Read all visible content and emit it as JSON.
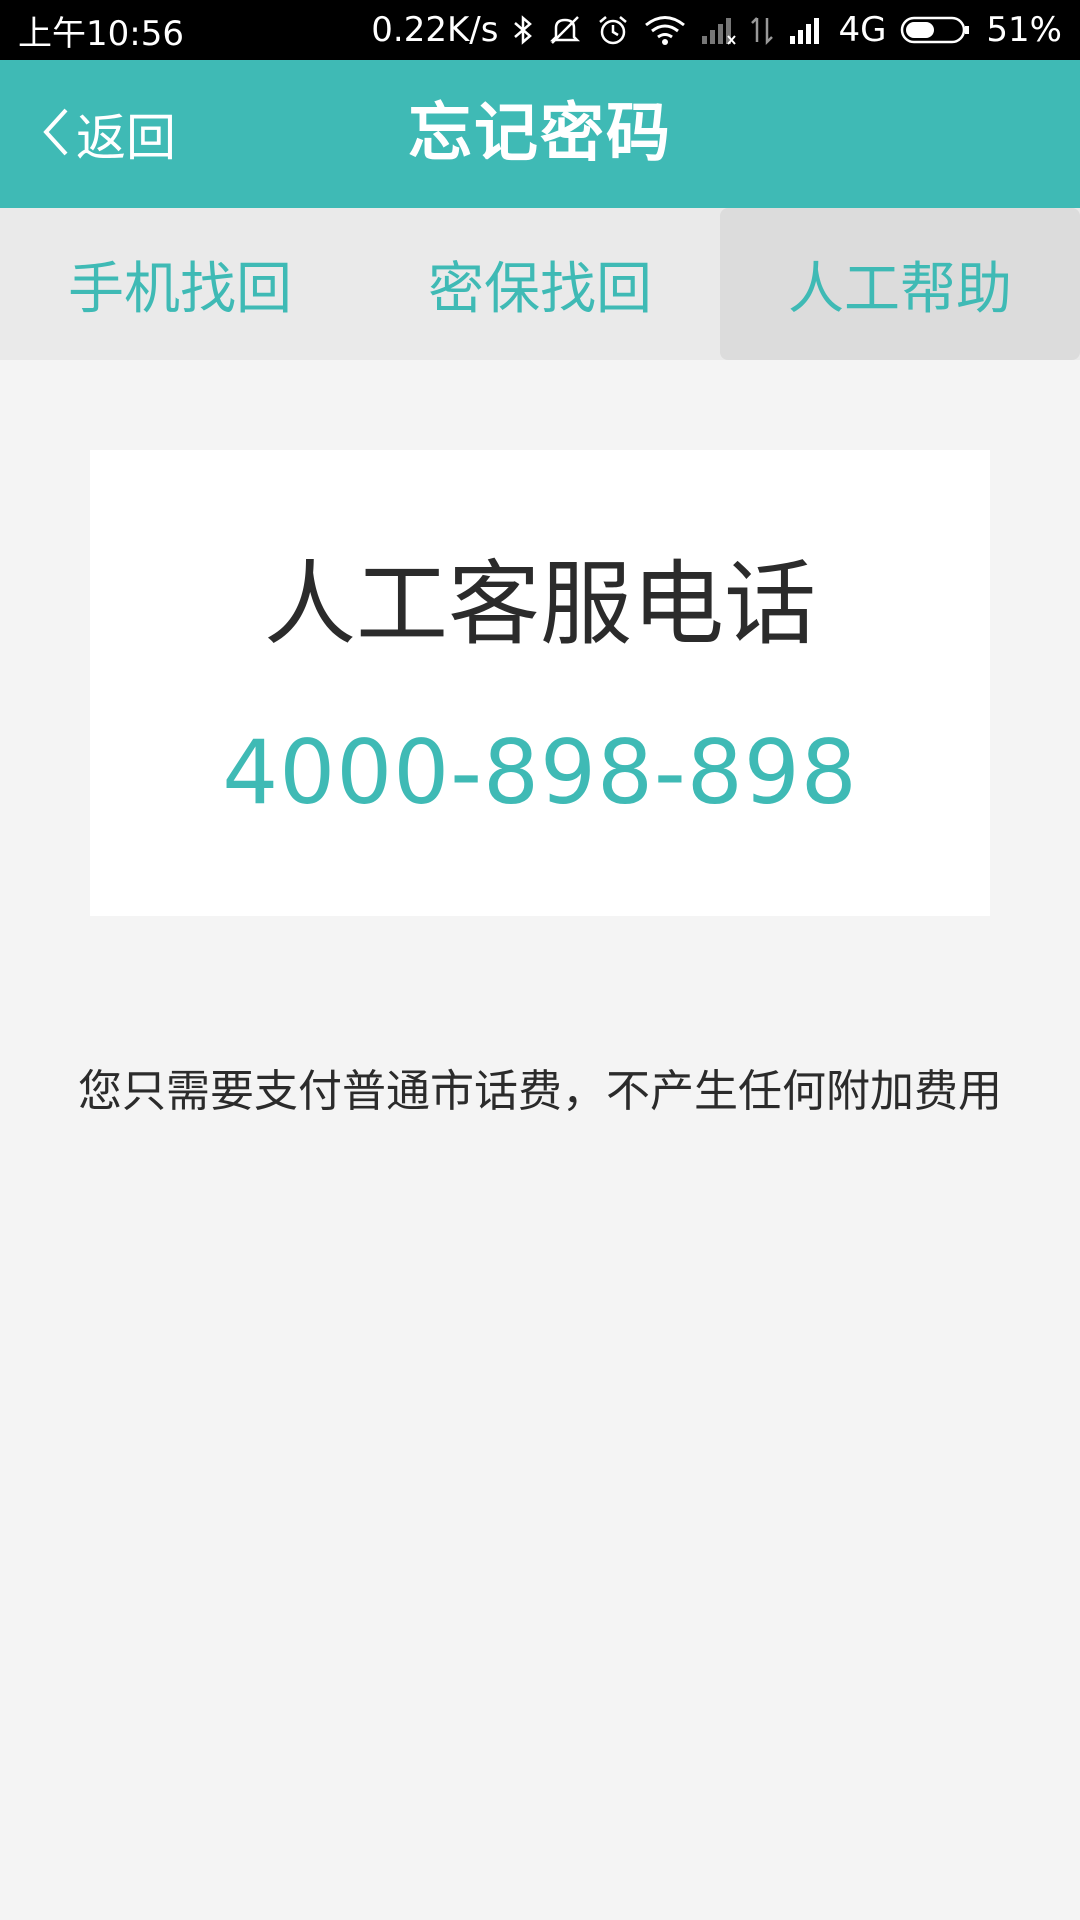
{
  "status_bar": {
    "time": "上午10:56",
    "net_speed": "0.22K/s",
    "network_type": "4G",
    "battery": "51%",
    "battery_level": 0.51,
    "icons": [
      "bluetooth-icon",
      "mute-icon",
      "alarm-icon",
      "wifi-icon",
      "signal-icon",
      "data-icon",
      "signal-icon",
      "battery-icon"
    ]
  },
  "header": {
    "back_label": "返回",
    "title": "忘记密码"
  },
  "tabs": [
    {
      "label": "手机找回",
      "active": false
    },
    {
      "label": "密保找回",
      "active": false
    },
    {
      "label": "人工帮助",
      "active": true
    }
  ],
  "card": {
    "title": "人工客服电话",
    "phone": "4000-898-898"
  },
  "note": "您只需要支付普通市话费，不产生任何附加费用",
  "colors": {
    "accent": "#3fbab5",
    "page_bg": "#f4f4f4",
    "tab_bg": "#eaeaea",
    "tab_active_bg": "#dcdcdc",
    "text": "#2b2b2b"
  }
}
